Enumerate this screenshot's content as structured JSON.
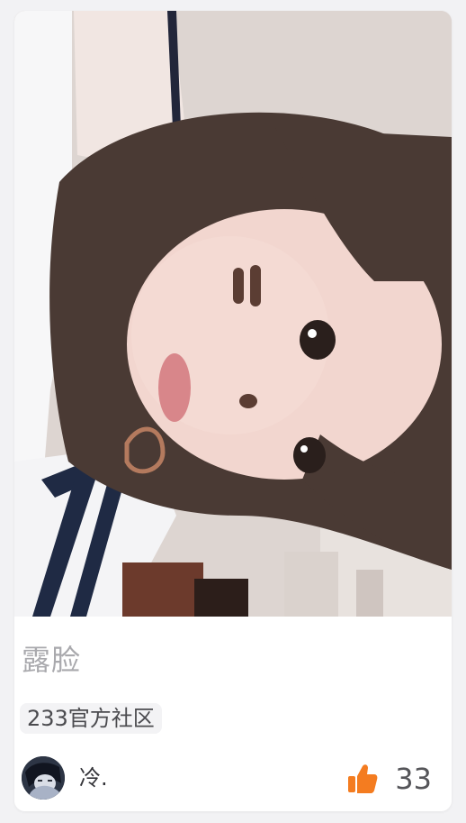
{
  "post": {
    "title": "露脸",
    "tag": "233官方社区",
    "author": "冷.",
    "likes": "33"
  },
  "icons": {
    "like": "thumbs-up-icon",
    "avatar": "user-avatar"
  },
  "colors": {
    "accent": "#f47c20",
    "title": "#a9a9ad",
    "tag_bg": "#f3f3f5"
  }
}
